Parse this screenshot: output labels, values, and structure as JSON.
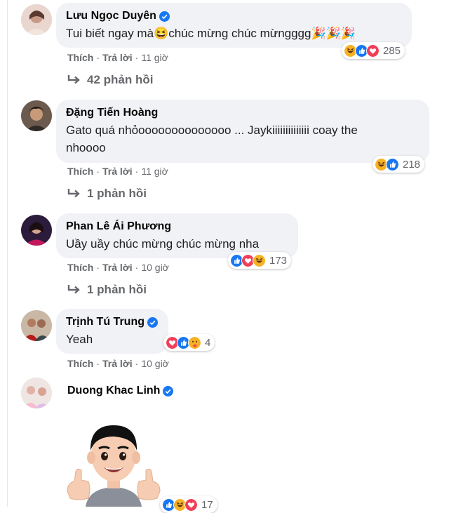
{
  "comments": [
    {
      "author": "Lưu Ngọc Duyên",
      "verified": true,
      "text": "Tui biết ngay mà😆chúc mừng chúc mừngggg🎉🎉🎉",
      "actions": {
        "like": "Thích",
        "reply": "Trả lời",
        "time": "11 giờ"
      },
      "reaction_icons": [
        "haha-icon",
        "like-icon",
        "love-icon"
      ],
      "reaction_count": "285",
      "replies": "42 phản hồi"
    },
    {
      "author": "Đặng Tiến Hoàng",
      "verified": false,
      "text_line1": "Gato quá nhỏoooooooooooooo ... Jaykiiiiiiiiiiiiii coay the",
      "text_line2": "nhoooo",
      "actions": {
        "like": "Thích",
        "reply": "Trả lời",
        "time": "11 giờ"
      },
      "reaction_icons": [
        "haha-icon",
        "like-icon"
      ],
      "reaction_count": "218",
      "replies": "1 phản hồi"
    },
    {
      "author": "Phan Lê Ái Phương",
      "verified": false,
      "text": "Uầy uầy chúc mừng chúc mừng nha",
      "actions": {
        "like": "Thích",
        "reply": "Trả lời",
        "time": "10 giờ"
      },
      "reaction_icons": [
        "like-icon",
        "love-icon",
        "haha-icon"
      ],
      "reaction_count": "173",
      "replies": "1 phản hồi"
    },
    {
      "author": "Trịnh Tú Trung",
      "verified": true,
      "text": "Yeah",
      "actions": {
        "like": "Thích",
        "reply": "Trả lời",
        "time": "10 giờ"
      },
      "reaction_icons": [
        "love-icon",
        "like-icon",
        "care-icon"
      ],
      "reaction_count": "4"
    },
    {
      "author": "Duong Khac Linh",
      "verified": true,
      "reaction_icons": [
        "like-icon",
        "haha-icon",
        "love-icon"
      ],
      "reaction_count": "17"
    }
  ],
  "colors": {
    "bubble": "#f0f2f5",
    "meta_text": "#65676b",
    "verified": "#1877f2",
    "like": "#1877f2",
    "love": "#f33e58",
    "haha": "#f7b125"
  }
}
